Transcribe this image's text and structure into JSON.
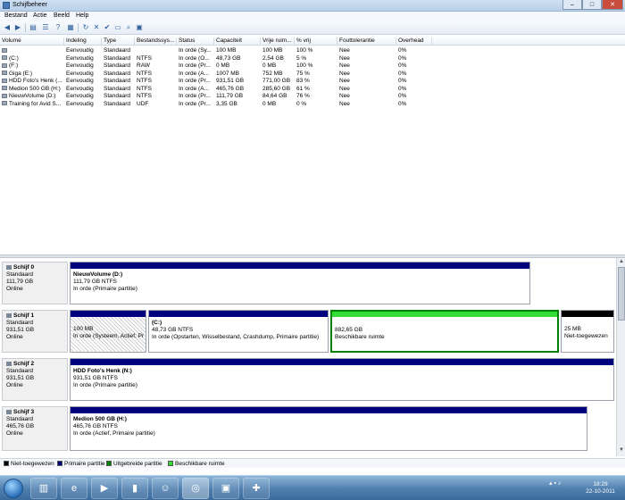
{
  "window": {
    "title": "Schijfbeheer",
    "min": "–",
    "max": "□",
    "close": "✕"
  },
  "menu": [
    "Bestand",
    "Actie",
    "Beeld",
    "Help"
  ],
  "columns": [
    "Volume",
    "Indeling",
    "Type",
    "Bestandssys...",
    "Status",
    "Capaciteit",
    "Vrije ruim...",
    "% vrij",
    "Fouttolerantie",
    "Overhead"
  ],
  "volumes": [
    [
      "",
      "Eenvoudig",
      "Standaard",
      "",
      "In orde (Sy...",
      "100 MB",
      "100 MB",
      "100 %",
      "Nee",
      "0%"
    ],
    [
      "(C:)",
      "Eenvoudig",
      "Standaard",
      "NTFS",
      "In orde (O...",
      "48,73 GB",
      "2,54 GB",
      "5 %",
      "Nee",
      "0%"
    ],
    [
      "(F:)",
      "Eenvoudig",
      "Standaard",
      "RAW",
      "In orde (Pr...",
      "0 MB",
      "0 MB",
      "100 %",
      "Nee",
      "0%"
    ],
    [
      "Giga (E:)",
      "Eenvoudig",
      "Standaard",
      "NTFS",
      "In orde (A...",
      "1007 MB",
      "752 MB",
      "75 %",
      "Nee",
      "0%"
    ],
    [
      "HDD Foto's Henk (...",
      "Eenvoudig",
      "Standaard",
      "NTFS",
      "In orde (Pr...",
      "931,51 GB",
      "771,00 GB",
      "83 %",
      "Nee",
      "0%"
    ],
    [
      "Medion 500 GB (H:)",
      "Eenvoudig",
      "Standaard",
      "NTFS",
      "In orde (A...",
      "465,76 GB",
      "285,60 GB",
      "61 %",
      "Nee",
      "0%"
    ],
    [
      "NieuwVolume (D:)",
      "Eenvoudig",
      "Standaard",
      "NTFS",
      "In orde (Pr...",
      "111,79 GB",
      "84,64 GB",
      "76 %",
      "Nee",
      "0%"
    ],
    [
      "Training for Avid S...",
      "Eenvoudig",
      "Standaard",
      "UDF",
      "In orde (Pr...",
      "3,35 GB",
      "0 MB",
      "0 %",
      "Nee",
      "0%"
    ]
  ],
  "disks": [
    {
      "name": "Schijf 0",
      "type": "Standaard",
      "size": "111,79 GB",
      "state": "Online",
      "partitions": [
        {
          "name": "NieuwVolume (D:)",
          "size": "111,79 GB NTFS",
          "status": "In orde (Primaire partitie)",
          "kind": "primary"
        }
      ]
    },
    {
      "name": "Schijf 1",
      "type": "Standaard",
      "size": "931,51 GB",
      "state": "Online",
      "partitions": [
        {
          "name": "",
          "size": "100 MB",
          "status": "In orde (Systeem, Actief, Pr",
          "kind": "primary-hatched"
        },
        {
          "name": "(C:)",
          "size": "48,73 GB NTFS",
          "status": "In orde (Opstarten, Wisselbestand, Crashdump, Primaire partitie)",
          "kind": "primary"
        },
        {
          "name": "",
          "size": "882,65 GB",
          "status": "Beschikbare ruimte",
          "kind": "free"
        },
        {
          "name": "",
          "size": "25 MB",
          "status": "Niet-toegewezen",
          "kind": "unallocated"
        }
      ]
    },
    {
      "name": "Schijf 2",
      "type": "Standaard",
      "size": "931,51 GB",
      "state": "Online",
      "partitions": [
        {
          "name": "HDD Foto's Henk (N:)",
          "size": "931,51 GB NTFS",
          "status": "In orde (Primaire partitie)",
          "kind": "primary"
        }
      ]
    },
    {
      "name": "Schijf 3",
      "type": "Standaard",
      "size": "465,76 GB",
      "state": "Online",
      "partitions": [
        {
          "name": "Medion 500 GB (H:)",
          "size": "465,76 GB NTFS",
          "status": "In orde (Actief, Primaire partitie)",
          "kind": "primary"
        }
      ]
    }
  ],
  "legend": [
    {
      "label": "Niet-toegewezen",
      "color": "#000000"
    },
    {
      "label": "Primaire partitie",
      "color": "#00007f"
    },
    {
      "label": "Uitgebreide partitie",
      "color": "#007f00"
    },
    {
      "label": "Beschikbare ruimte",
      "color": "#33dd33"
    }
  ],
  "colors": {
    "primary": "#00007f",
    "free": "#33dd33",
    "free_border": "#008000",
    "unallocated": "#000000"
  },
  "taskbar": {
    "icons": [
      "explorer-icon",
      "ie-icon",
      "media-player-icon",
      "folder-icon",
      "messenger-icon",
      "disk-management-icon",
      "control-panel-icon",
      "toolbox-icon"
    ]
  },
  "clock": {
    "time": "18:29",
    "date": "22-10-2011"
  }
}
